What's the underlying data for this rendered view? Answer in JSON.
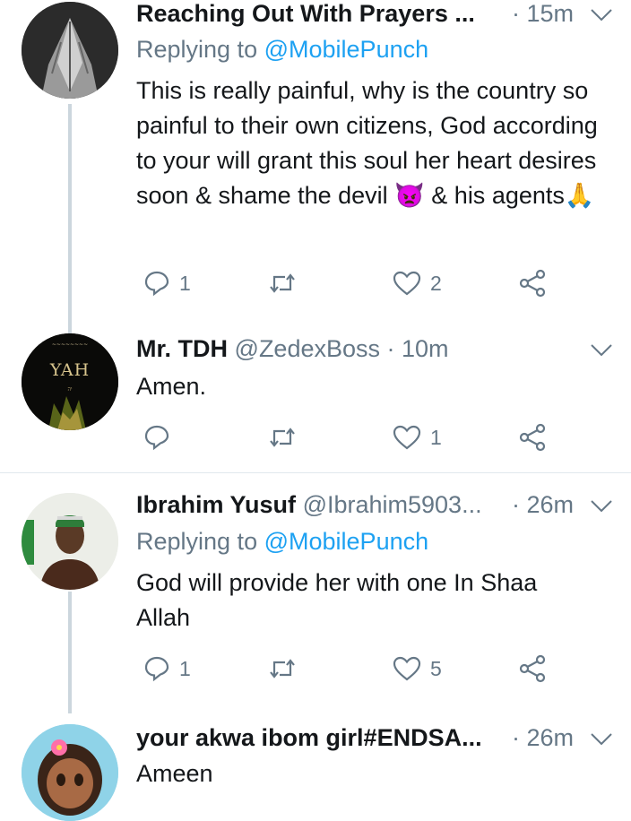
{
  "tweets": [
    {
      "name": "Reaching Out With Prayers ...",
      "handle": "",
      "time": "· 15m",
      "replying_prefix": "Replying to",
      "replying_to": "@MobilePunch",
      "text": "This is really painful, why is the country so painful to their own citizens, God according to your will grant this soul her heart desires soon & shame the devil 👿 & his agents🙏",
      "reply_count": "1",
      "retweet_count": "",
      "like_count": "2"
    },
    {
      "name": "Mr. TDH",
      "handle": "@ZedexBoss",
      "time": "· 10m",
      "avatar_text": "YAH",
      "text": "Amen.",
      "reply_count": "",
      "retweet_count": "",
      "like_count": "1"
    },
    {
      "name": "Ibrahim Yusuf",
      "handle": "@Ibrahim5903...",
      "time": "· 26m",
      "replying_prefix": "Replying to",
      "replying_to": "@MobilePunch",
      "text": "God will provide her with one In Shaa Allah",
      "reply_count": "1",
      "retweet_count": "",
      "like_count": "5"
    },
    {
      "name": "your akwa ibom girl#ENDSA...",
      "handle": "",
      "time": "· 26m",
      "text": "Ameen"
    }
  ],
  "colors": {
    "text": "#14171a",
    "muted": "#657786",
    "link": "#1da1f2",
    "line": "#ccd6dd"
  }
}
